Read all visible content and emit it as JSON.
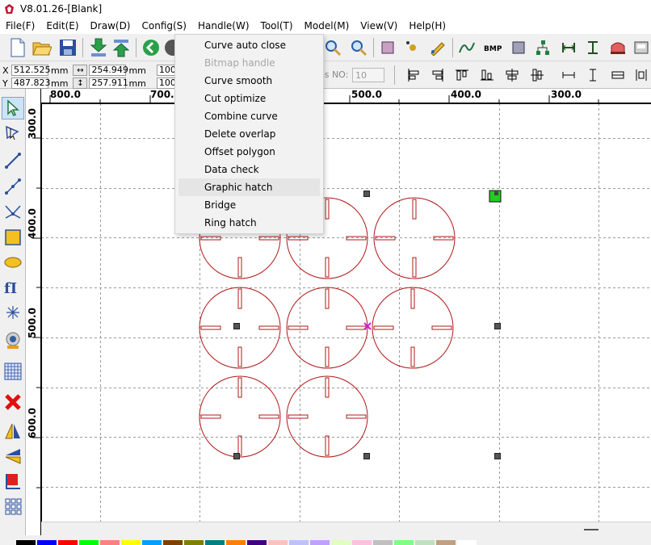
{
  "window": {
    "title": "V8.01.26-[Blank]"
  },
  "menu": [
    {
      "label": "File(F)"
    },
    {
      "label": "Edit(E)"
    },
    {
      "label": "Draw(D)"
    },
    {
      "label": "Config(S)"
    },
    {
      "label": "Handle(W)"
    },
    {
      "label": "Tool(T)"
    },
    {
      "label": "Model(M)"
    },
    {
      "label": "View(V)"
    },
    {
      "label": "Help(H)"
    }
  ],
  "handle_menu": {
    "items": [
      {
        "label": "Curve auto close",
        "enabled": true
      },
      {
        "label": "Bitmap handle",
        "enabled": false
      },
      {
        "label": "Curve smooth",
        "enabled": true
      },
      {
        "label": "Cut optimize",
        "enabled": true
      },
      {
        "label": "Combine curve",
        "enabled": true
      },
      {
        "label": "Delete overlap",
        "enabled": true
      },
      {
        "label": "Offset polygon",
        "enabled": true
      },
      {
        "label": "Data check",
        "enabled": true
      },
      {
        "label": "Graphic hatch",
        "enabled": true,
        "highlighted": true
      },
      {
        "label": "Bridge",
        "enabled": true
      },
      {
        "label": "Ring hatch",
        "enabled": true
      }
    ]
  },
  "coords": {
    "x_label": "X",
    "x_value": "512.525",
    "x_unit": "mm",
    "y_label": "Y",
    "y_value": "487.823",
    "y_unit": "mm",
    "width_value": "254.949",
    "width_unit": "mm",
    "height_value": "257.911",
    "height_unit": "mm",
    "scale_x": "100",
    "scale_y": "100"
  },
  "pass": {
    "label": "ss NO:",
    "value": "10"
  },
  "rulers": {
    "horizontal": [
      "800.0",
      "700.0",
      "500.0",
      "400.0",
      "300.0"
    ],
    "vertical": [
      "300.0",
      "400.0",
      "500.0",
      "600.0"
    ]
  },
  "colors": {
    "shape_stroke": "#b01818",
    "handle": "#555555",
    "center_mark": "#d020d0",
    "rotate_handle": "#22cc22",
    "palette": [
      "#000000",
      "#0000ff",
      "#ff0000",
      "#00ff00",
      "#ff8080",
      "#ffff00",
      "#00a0ff",
      "#804000",
      "#808000",
      "#008080",
      "#ff8000",
      "#400080",
      "#ffc0c0",
      "#c0c0ff",
      "#c0a0ff",
      "#e0ffc0",
      "#ffc0e0",
      "#c0c0c0",
      "#80ff80",
      "#c0e0c0",
      "#c0a080",
      "#ffffff"
    ]
  },
  "icons": {
    "left": [
      "select-arrow-icon",
      "node-edit-icon",
      "line-icon",
      "polyline-icon",
      "curve-icon",
      "rectangle-icon",
      "ellipse-icon",
      "text-icon",
      "point-icon",
      "camera-icon",
      "grid-icon",
      "delete-icon",
      "mirror-horizontal-icon",
      "mirror-vertical-icon",
      "flag-icon",
      "array-icon"
    ]
  }
}
